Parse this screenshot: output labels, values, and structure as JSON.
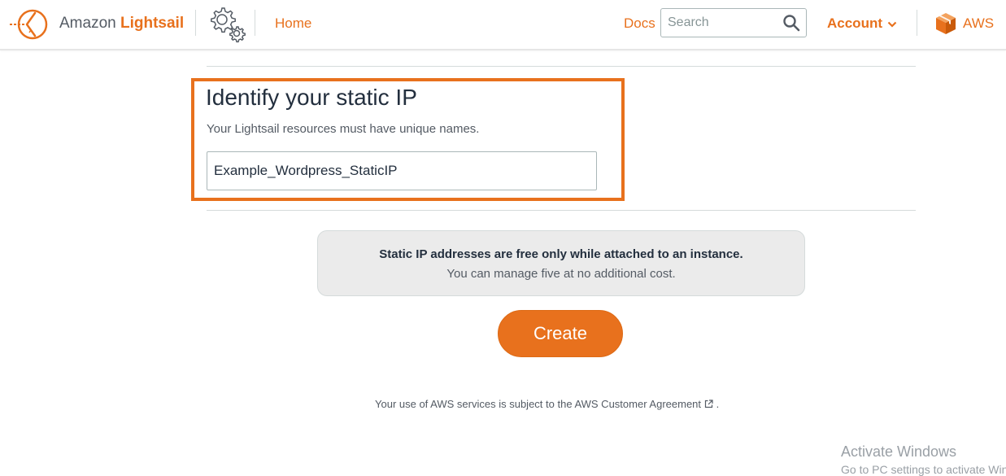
{
  "header": {
    "logo_prefix": "Amazon",
    "logo_brand": "Lightsail",
    "home_label": "Home",
    "docs_label": "Docs",
    "search_placeholder": "Search",
    "account_label": "Account",
    "aws_label": "AWS"
  },
  "identify": {
    "title": "Identify your static IP",
    "description": "Your Lightsail resources must have unique names.",
    "name_value": "Example_Wordpress_StaticIP"
  },
  "info": {
    "strong": "Static IP addresses are free only while attached to an instance.",
    "sub": "You can manage five at no additional cost."
  },
  "create_label": "Create",
  "footer": {
    "text": "Your use of AWS services is subject to the AWS Customer Agreement",
    "period": "."
  },
  "watermark": {
    "title": "Activate Windows",
    "sub": "Go to PC settings to activate Windows."
  },
  "colors": {
    "accent": "#e8711d",
    "text_dark": "#232f3e",
    "text_muted": "#545b64",
    "info_bg": "#ebebeb"
  },
  "icons": [
    "lightsail-logo-icon",
    "settings-gear-icon",
    "search-icon",
    "chevron-down-icon",
    "aws-cube-icon",
    "external-link-icon"
  ]
}
